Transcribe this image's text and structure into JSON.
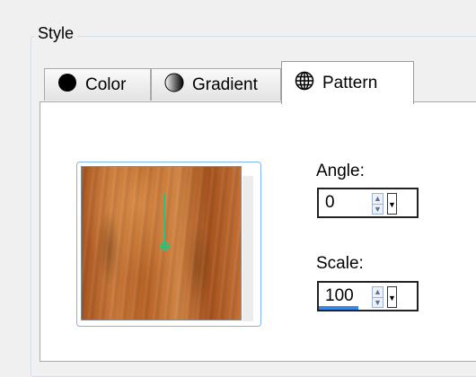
{
  "style_group": {
    "title": "Style"
  },
  "tabs": [
    {
      "label": "Color",
      "icon": "black-circle-icon",
      "active": false
    },
    {
      "label": "Gradient",
      "icon": "half-circle-icon",
      "active": false
    },
    {
      "label": "Pattern",
      "icon": "globe-grid-icon",
      "active": true
    }
  ],
  "pattern_preview": {
    "texture": "wood",
    "handle_color": "#2fc07f"
  },
  "angle": {
    "label": "Angle:",
    "value": "0"
  },
  "scale": {
    "label": "Scale:",
    "value": "100",
    "slider_fraction": 0.4
  },
  "colors": {
    "focus_border": "#7eb4ea",
    "scale_bar": "#3a86e8"
  }
}
